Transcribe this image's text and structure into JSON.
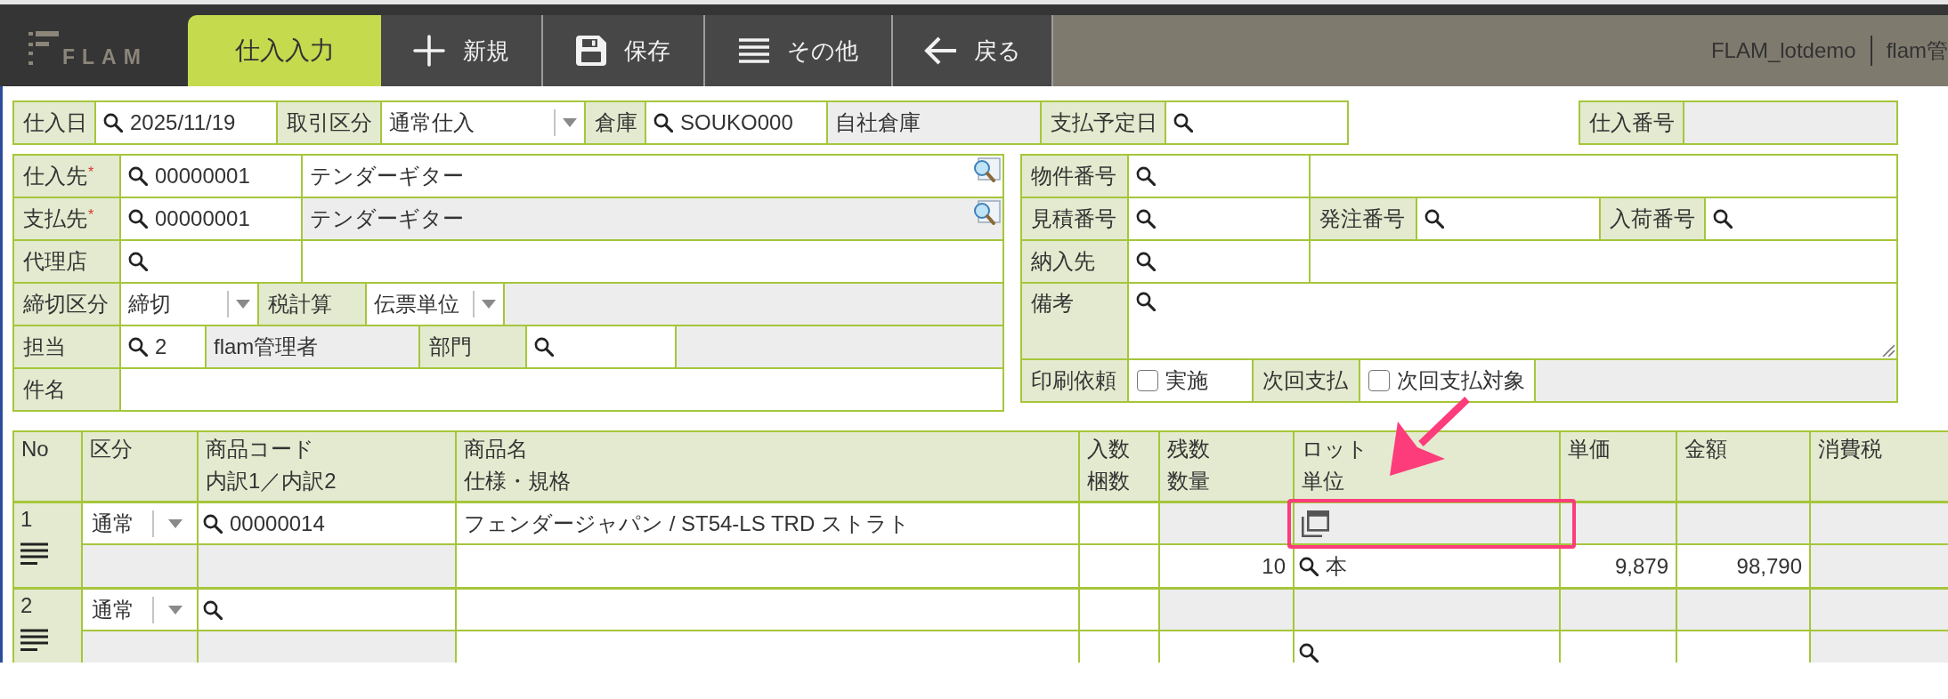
{
  "header": {
    "logo": "FLAM",
    "page_title": "仕入入力",
    "toolbar": [
      {
        "label": "新規",
        "kind": "new"
      },
      {
        "label": "保存",
        "kind": "save"
      },
      {
        "label": "その他",
        "kind": "more"
      },
      {
        "label": "戻る",
        "kind": "back"
      }
    ],
    "company": "FLAM_lotdemo",
    "user": "flam管"
  },
  "top_row": [
    {
      "kind": "label",
      "text": "仕入日"
    },
    {
      "kind": "search",
      "value": "2025/11/19"
    },
    {
      "kind": "label",
      "text": "取引区分"
    },
    {
      "kind": "select",
      "value": "通常仕入"
    },
    {
      "kind": "label",
      "text": "倉庫"
    },
    {
      "kind": "search",
      "value": "SOUKO000"
    },
    {
      "kind": "readonly",
      "value": "自社倉庫"
    },
    {
      "kind": "label",
      "text": "支払予定日"
    },
    {
      "kind": "search"
    }
  ],
  "number_field": [
    {
      "kind": "label",
      "text": "仕入番号"
    },
    {
      "kind": "readonly"
    }
  ],
  "left_panel": [
    [
      {
        "kind": "label",
        "text": "仕入先",
        "mark": "*"
      },
      {
        "kind": "search",
        "value": "00000001"
      },
      {
        "kind": "text",
        "value": "テンダーギター",
        "lookup": true
      }
    ],
    [
      {
        "kind": "label",
        "text": "支払先",
        "mark": "*"
      },
      {
        "kind": "search",
        "value": "00000001"
      },
      {
        "kind": "readonly",
        "value": "テンダーギター",
        "lookup": true
      }
    ],
    [
      {
        "kind": "label",
        "text": "代理店"
      },
      {
        "kind": "search"
      },
      {
        "kind": "text"
      }
    ],
    [
      {
        "kind": "label",
        "text": "締切区分"
      },
      {
        "kind": "select",
        "value": "締切"
      },
      {
        "kind": "label",
        "text": "税計算"
      },
      {
        "kind": "select",
        "value": "伝票単位"
      },
      {
        "kind": "readonly"
      }
    ],
    [
      {
        "kind": "label",
        "text": "担当"
      },
      {
        "kind": "search",
        "value": "2"
      },
      {
        "kind": "readonly",
        "value": "flam管理者"
      },
      {
        "kind": "label",
        "text": "部門"
      },
      {
        "kind": "search"
      },
      {
        "kind": "readonly"
      }
    ],
    [
      {
        "kind": "label",
        "text": "件名"
      },
      {
        "kind": "text"
      }
    ]
  ],
  "right_panel": [
    [
      {
        "kind": "label",
        "text": "物件番号"
      },
      {
        "kind": "search"
      },
      {
        "kind": "text"
      }
    ],
    [
      {
        "kind": "label",
        "text": "見積番号"
      },
      {
        "kind": "search"
      },
      {
        "kind": "label",
        "text": "発注番号"
      },
      {
        "kind": "search"
      },
      {
        "kind": "label",
        "text": "入荷番号"
      },
      {
        "kind": "search"
      }
    ],
    [
      {
        "kind": "label",
        "text": "納入先"
      },
      {
        "kind": "search"
      },
      {
        "kind": "text"
      }
    ],
    [
      {
        "kind": "label",
        "text": "備考"
      },
      {
        "kind": "textarea"
      }
    ],
    [
      {
        "kind": "label",
        "text": "印刷依頼"
      },
      {
        "kind": "checkbox",
        "text": "実施",
        "checked": false
      },
      {
        "kind": "label",
        "text": "次回支払"
      },
      {
        "kind": "checkbox",
        "text": "次回支払対象",
        "checked": false
      },
      {
        "kind": "readonly"
      }
    ]
  ],
  "table": {
    "columns": [
      {
        "lines": [
          "No"
        ]
      },
      {
        "lines": [
          "区分"
        ]
      },
      {
        "lines": [
          "商品コード",
          "内訳1／内訳2"
        ]
      },
      {
        "lines": [
          "商品名",
          "仕様・規格"
        ]
      },
      {
        "lines": [
          "入数",
          "梱数"
        ]
      },
      {
        "lines": [
          "残数",
          "数量"
        ]
      },
      {
        "lines": [
          "ロット",
          "単位"
        ]
      },
      {
        "lines": [
          "単価"
        ]
      },
      {
        "lines": [
          "金額"
        ]
      },
      {
        "lines": [
          "消費税"
        ]
      }
    ],
    "rows": [
      {
        "no": "1",
        "lines": [
          [
            {
              "kind": "select",
              "value": "通常"
            },
            {
              "kind": "search",
              "value": "00000014"
            },
            {
              "kind": "text",
              "value": "フェンダージャパン / ST54-LS TRD ストラト"
            },
            {
              "kind": "text"
            },
            {
              "kind": "readonly"
            },
            {
              "kind": "lot"
            },
            {
              "kind": "readonly"
            },
            {
              "kind": "readonly"
            },
            {
              "kind": "readonly"
            }
          ],
          [
            {
              "kind": "readonly"
            },
            {
              "kind": "readonly"
            },
            {
              "kind": "text"
            },
            {
              "kind": "text"
            },
            {
              "kind": "number",
              "value": "10"
            },
            {
              "kind": "search",
              "value": "本"
            },
            {
              "kind": "number",
              "value": "9,879"
            },
            {
              "kind": "number",
              "value": "98,790"
            },
            {
              "kind": "readonly"
            }
          ]
        ]
      },
      {
        "no": "2",
        "lines": [
          [
            {
              "kind": "select",
              "value": "通常"
            },
            {
              "kind": "search"
            },
            {
              "kind": "text"
            },
            {
              "kind": "text"
            },
            {
              "kind": "readonly"
            },
            {
              "kind": "readonly"
            },
            {
              "kind": "readonly"
            },
            {
              "kind": "readonly"
            },
            {
              "kind": "readonly"
            }
          ],
          [
            {
              "kind": "readonly"
            },
            {
              "kind": "readonly"
            },
            {
              "kind": "text"
            },
            {
              "kind": "text"
            },
            {
              "kind": "number"
            },
            {
              "kind": "search"
            },
            {
              "kind": "number"
            },
            {
              "kind": "number"
            },
            {
              "kind": "readonly"
            }
          ]
        ]
      }
    ]
  }
}
